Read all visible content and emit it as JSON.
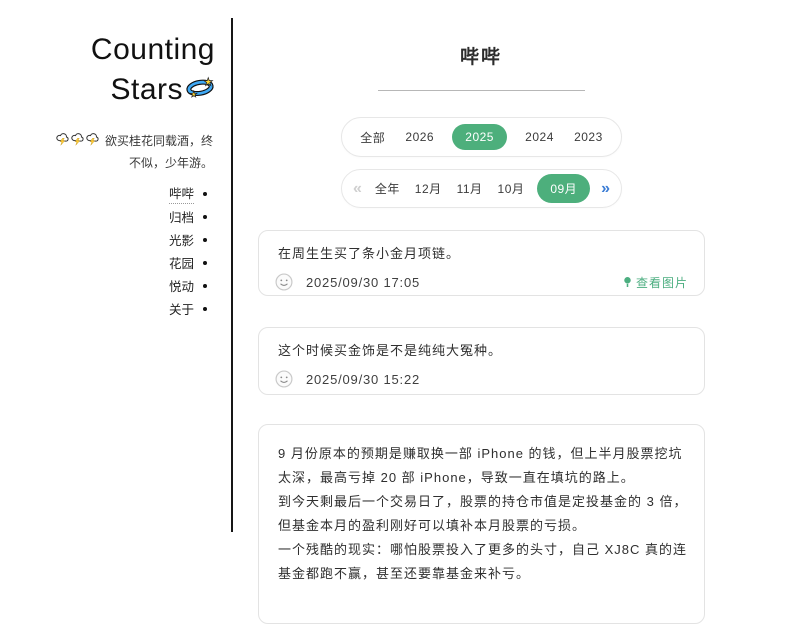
{
  "sidebar": {
    "title_line1": "Counting",
    "title_line2": "Stars",
    "tagline_line1": "欲买桂花同载酒，终",
    "tagline_line2": "不似，少年游。",
    "nav": [
      {
        "label": "哔哔",
        "active": true
      },
      {
        "label": "归档",
        "active": false
      },
      {
        "label": "光影",
        "active": false
      },
      {
        "label": "花园",
        "active": false
      },
      {
        "label": "悦动",
        "active": false
      },
      {
        "label": "关于",
        "active": false
      }
    ]
  },
  "main": {
    "title": "哔哔",
    "year_tabs": [
      "全部",
      "2026",
      "2025",
      "2024",
      "2023"
    ],
    "year_selected": "2025",
    "month_tabs": [
      "全年",
      "12月",
      "11月",
      "10月",
      "09月"
    ],
    "month_selected": "09月",
    "pager_prev": "«",
    "pager_next": "»",
    "posts": [
      {
        "text": "在周生生买了条小金月项链。",
        "time": "2025/09/30 17:05",
        "link": "查看图片"
      },
      {
        "text": "这个时候买金饰是不是纯纯大冤种。",
        "time": "2025/09/30 15:22"
      },
      {
        "paragraphs": [
          "9 月份原本的预期是赚取换一部 iPhone 的钱，但上半月股票挖坑太深，最高亏掉 20 部 iPhone，导致一直在填坑的路上。",
          "到今天剩最后一个交易日了，股票的持仓市值是定投基金的 3 倍，但基金本月的盈利刚好可以填补本月股票的亏损。",
          "一个残酷的现实：哪怕股票投入了更多的头寸，自己 XJ8C 真的连基金都跑不赢，甚至还要靠基金来补亏。"
        ]
      }
    ]
  },
  "colors": {
    "accent_green": "#4daf7c",
    "link_green": "#4cae80",
    "pager_blue": "#3a7cd5"
  }
}
